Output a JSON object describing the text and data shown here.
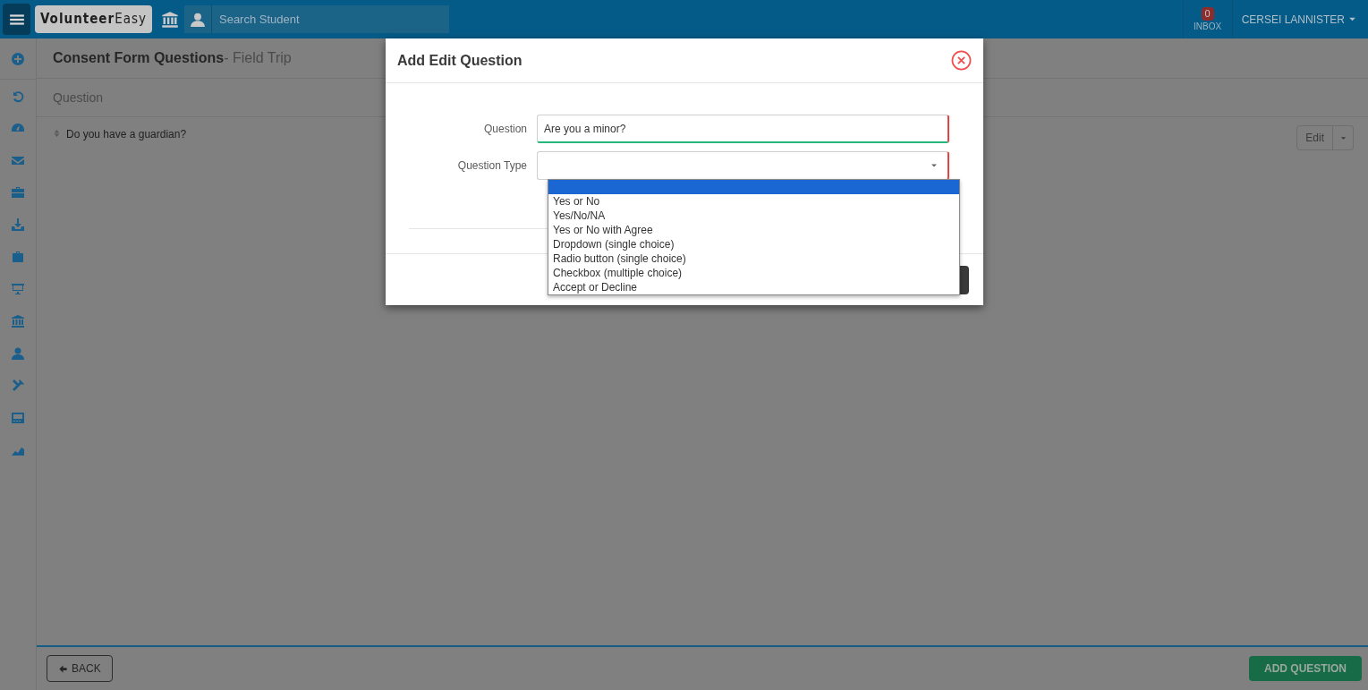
{
  "topbar": {
    "logo": {
      "first": "Volunteer",
      "second": "Easy"
    },
    "search": {
      "placeholder": "Search Student"
    },
    "inbox": {
      "count": "0",
      "label": "INBOX"
    },
    "user": "CERSEI LANNISTER"
  },
  "page": {
    "title": "Consent Form Questions",
    "subtitle": "- Field Trip",
    "column": "Question",
    "rows": [
      {
        "text": "Do you have a guardian?",
        "action": "Edit"
      }
    ]
  },
  "footer": {
    "back": "BACK",
    "add": "ADD QUESTION"
  },
  "modal": {
    "title": "Add Edit Question",
    "fields": [
      {
        "label": "Question",
        "kind": "text",
        "value": "Are you a minor?"
      },
      {
        "label": "Question Type",
        "kind": "select"
      }
    ],
    "options": [
      {
        "selected": true
      },
      {
        "label": "Yes or No",
        "selected": false
      },
      {
        "label": "Yes/No/NA",
        "selected": false
      },
      {
        "label": "Yes or No with Agree",
        "selected": false
      },
      {
        "label": "Dropdown (single choice)",
        "selected": false
      },
      {
        "label": "Radio button (single choice)",
        "selected": false
      },
      {
        "label": "Checkbox (multiple choice)",
        "selected": false
      },
      {
        "label": "Accept or Decline",
        "selected": false
      }
    ]
  }
}
